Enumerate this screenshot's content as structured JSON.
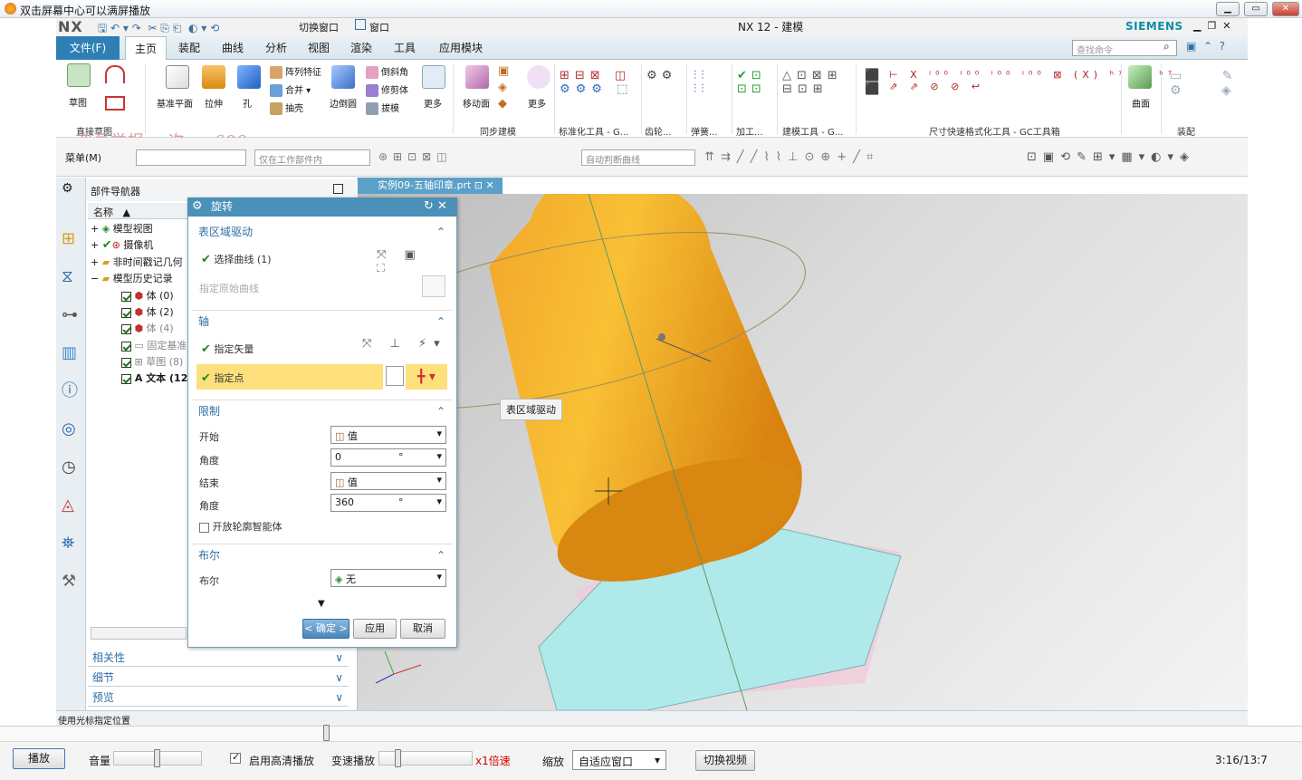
{
  "player": {
    "title": "双击屏幕中心可以满屏播放",
    "play": "播放",
    "volume": "音量",
    "hd": "启用高清播放",
    "speed": "变速播放",
    "speed_value": "x1倍速",
    "zoom": "缩放",
    "zoom_value": "自适应窗口",
    "switch": "切换视频",
    "time": "3:16/13:7",
    "seek_progress": 0.25
  },
  "nx": {
    "logo": "NX",
    "title": "NX 12 - 建模",
    "brand": "SIEMENS",
    "switch_window": "切换窗口",
    "window": "窗口",
    "search_placeholder": "查找命令"
  },
  "tabs": [
    "文件(F)",
    "主页",
    "装配",
    "曲线",
    "分析",
    "视图",
    "渲染",
    "工具",
    "应用模块"
  ],
  "ribbon": {
    "sketch": "草图",
    "datum_plane": "基准平面",
    "extrude": "拉伸",
    "hole": "孔",
    "pattern": "阵列特征",
    "unite": "合并",
    "shell": "抽壳",
    "edge_blend": "边倒圆",
    "chamfer": "倒斜角",
    "trim": "修剪体",
    "draft": "拔模",
    "more": "更多",
    "move_face": "移动面",
    "more2": "更多",
    "surface": "曲面",
    "groups": [
      "直接草图",
      "同步建模",
      "标准化工具 - G...",
      "齿轮...",
      "弹簧...",
      "加工...",
      "建模工具 - G...",
      "尺寸快速格式化工具 - GC工具箱",
      "装配"
    ]
  },
  "watermark": "盗录举报 一次 … 699",
  "selbar": {
    "menu": "菜单(M)",
    "filter": "仅在工作部件内",
    "curve_rule": "自动判断曲线"
  },
  "navigator": {
    "title": "部件导航器",
    "col": "名称",
    "items": [
      "模型视图",
      "摄像机",
      "非时间戳记几何",
      "模型历史记录",
      "体 (0)",
      "体 (2)",
      "体 (4)",
      "固定基准",
      "草图 (8)",
      "文本 (12"
    ],
    "sections": [
      "相关性",
      "细节",
      "预览"
    ]
  },
  "viewport": {
    "tab": "实例09-五轴印章.prt",
    "tooltip": "表区域驱动"
  },
  "dialog": {
    "title": "旋转",
    "sec1": "表区域驱动",
    "sel_curve": "选择曲线 (1)",
    "origin_curve": "指定原始曲线",
    "sec2": "轴",
    "vector": "指定矢量",
    "point": "指定点",
    "sec3": "限制",
    "start": "开始",
    "start_opt": "值",
    "angle1": "角度",
    "angle1_val": "0",
    "deg": "°",
    "end": "结束",
    "end_opt": "值",
    "angle2": "角度",
    "angle2_val": "360",
    "open_profile": "开放轮廓智能体",
    "sec4": "布尔",
    "bool": "布尔",
    "bool_val": "无",
    "ok": "< 确定 >",
    "apply": "应用",
    "cancel": "取消"
  },
  "status": "使用光标指定位置"
}
